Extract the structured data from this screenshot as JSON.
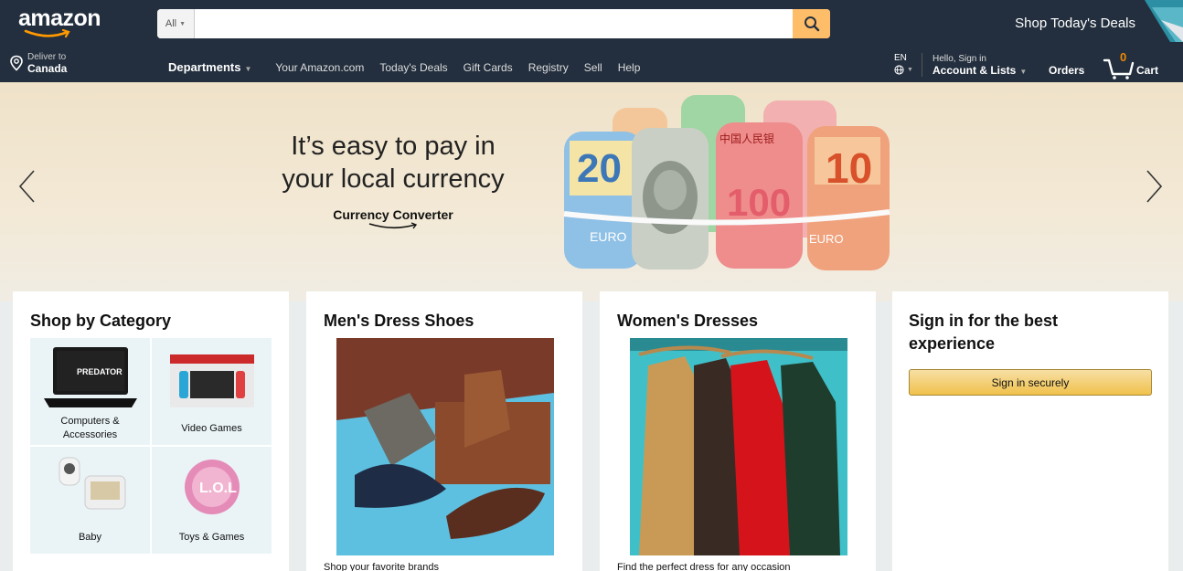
{
  "header": {
    "logo_text": "amazon",
    "search": {
      "category": "All",
      "placeholder": "",
      "value": ""
    },
    "promo_text": "Shop Today's Deals"
  },
  "nav": {
    "deliver_label": "Deliver to",
    "deliver_country": "Canada",
    "departments": "Departments",
    "links": [
      "Your Amazon.com",
      "Today's Deals",
      "Gift Cards",
      "Registry",
      "Sell",
      "Help"
    ],
    "language": "EN",
    "account_greeting": "Hello, Sign in",
    "account_label": "Account & Lists",
    "orders": "Orders",
    "cart_count": "0",
    "cart_label": "Cart"
  },
  "hero": {
    "title_line1": "It’s easy to pay in",
    "title_line2": "your local currency",
    "subtitle": "Currency Converter"
  },
  "cards": {
    "category": {
      "title": "Shop by Category",
      "items": [
        {
          "label": "Computers &",
          "label2": "Accessories"
        },
        {
          "label": "Video Games"
        },
        {
          "label": "Baby"
        },
        {
          "label": "Toys & Games"
        }
      ]
    },
    "shoes": {
      "title": "Men's Dress Shoes",
      "caption": "Shop your favorite brands"
    },
    "dresses": {
      "title": "Women's Dresses",
      "caption": "Find the perfect dress for any occasion"
    },
    "signin": {
      "title_line1": "Sign in for the best",
      "title_line2": "experience",
      "button": "Sign in securely"
    }
  },
  "colors": {
    "header_bg": "#232f3e",
    "search_button": "#febd69",
    "cart_count": "#f08804",
    "signin_button": "#f0c14b"
  }
}
